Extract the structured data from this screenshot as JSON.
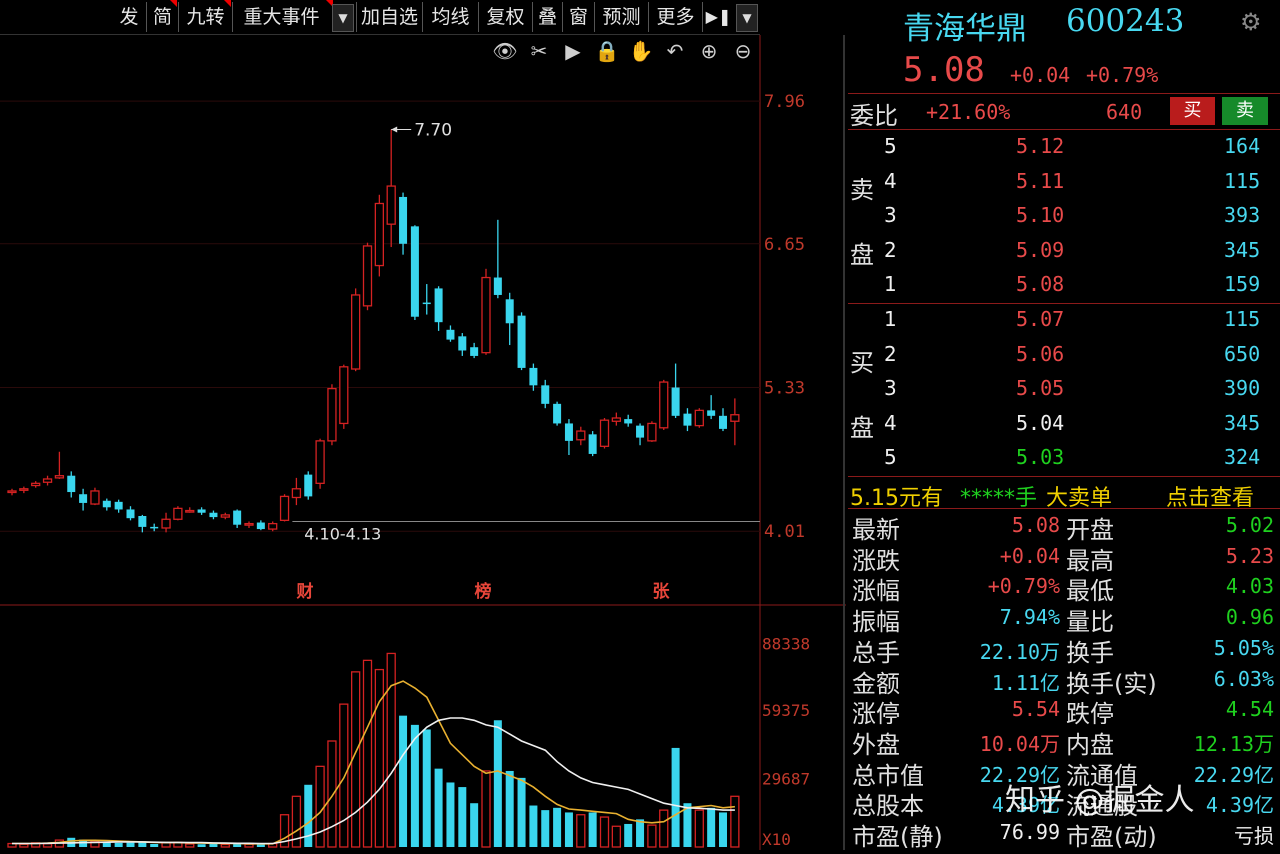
{
  "toolbar": {
    "buttons": [
      "发",
      "简",
      "九转",
      "重大事件",
      "加自选",
      "均线",
      "复权",
      "叠",
      "窗",
      "预测",
      "更多"
    ],
    "chart_tools": [
      "eye-icon",
      "scissors-icon",
      "play-icon",
      "lock-icon",
      "hand-icon",
      "undo-icon",
      "zoom-in-icon",
      "zoom-out-icon"
    ]
  },
  "stock": {
    "name": "青海华鼎",
    "code": "600243",
    "price": "5.08",
    "change": "+0.04",
    "change_pct": "+0.79%"
  },
  "order_ratio": {
    "label": "委比",
    "value": "+21.60%",
    "diff": "640",
    "buy_label": "买",
    "sell_label": "卖"
  },
  "sell_book": {
    "label_chars": [
      "卖",
      "盘"
    ],
    "levels": [
      {
        "level": "5",
        "price": "5.12",
        "vol": "164"
      },
      {
        "level": "4",
        "price": "5.11",
        "vol": "115"
      },
      {
        "level": "3",
        "price": "5.10",
        "vol": "393"
      },
      {
        "level": "2",
        "price": "5.09",
        "vol": "345"
      },
      {
        "level": "1",
        "price": "5.08",
        "vol": "159"
      }
    ]
  },
  "buy_book": {
    "label_chars": [
      "买",
      "盘"
    ],
    "levels": [
      {
        "level": "1",
        "price": "5.07",
        "vol": "115"
      },
      {
        "level": "2",
        "price": "5.06",
        "vol": "650"
      },
      {
        "level": "3",
        "price": "5.05",
        "vol": "390"
      },
      {
        "level": "4",
        "price": "5.04",
        "vol": "345"
      },
      {
        "level": "5",
        "price": "5.03",
        "vol": "324"
      }
    ]
  },
  "big_order": {
    "price_text": "5.15元有",
    "stars": "*****手",
    "label": "大卖单",
    "link": "点击查看"
  },
  "stats": [
    {
      "l1": "最新",
      "v1": "5.08",
      "c1": "red",
      "l2": "开盘",
      "v2": "5.02",
      "c2": "green"
    },
    {
      "l1": "涨跌",
      "v1": "+0.04",
      "c1": "red",
      "l2": "最高",
      "v2": "5.23",
      "c2": "red"
    },
    {
      "l1": "涨幅",
      "v1": "+0.79%",
      "c1": "red",
      "l2": "最低",
      "v2": "4.03",
      "c2": "green"
    },
    {
      "l1": "振幅",
      "v1": "7.94%",
      "c1": "cyan",
      "l2": "量比",
      "v2": "0.96",
      "c2": "green"
    },
    {
      "l1": "总手",
      "v1": "22.10万",
      "c1": "cyan",
      "l2": "换手",
      "v2": "5.05%",
      "c2": "cyan"
    },
    {
      "l1": "金额",
      "v1": "1.11亿",
      "c1": "cyan",
      "l2": "换手(实)",
      "v2": "6.03%",
      "c2": "cyan"
    },
    {
      "l1": "涨停",
      "v1": "5.54",
      "c1": "red",
      "l2": "跌停",
      "v2": "4.54",
      "c2": "green"
    },
    {
      "l1": "外盘",
      "v1": "10.04万",
      "c1": "red",
      "l2": "内盘",
      "v2": "12.13万",
      "c2": "green"
    },
    {
      "l1": "总市值",
      "v1": "22.29亿",
      "c1": "cyan",
      "l2": "流通值",
      "v2": "22.29亿",
      "c2": "cyan"
    },
    {
      "l1": "总股本",
      "v1": "4.39亿",
      "c1": "cyan",
      "l2": "流通股",
      "v2": "4.39亿",
      "c2": "cyan"
    },
    {
      "l1": "市盈(静)",
      "v1": "76.99",
      "c1": "white",
      "l2": "市盈(动)",
      "v2": "亏损",
      "c2": "white"
    }
  ],
  "watermark": "知乎 @掘金人",
  "colors": {
    "up": "#d42222",
    "down": "#3ad6ee",
    "ma_fast": "#e8b030",
    "ma_slow": "#f0f0f0",
    "grid": "#8b1a1a"
  },
  "chart_data": {
    "type": "candlestick",
    "price_axis_ticks": [
      "7.96",
      "6.65",
      "5.33",
      "4.01"
    ],
    "price_ylim": [
      3.7,
      8.2
    ],
    "volume_axis_ticks": [
      "88338",
      "59375",
      "29687",
      "X10"
    ],
    "volume_ylim": [
      0,
      92000
    ],
    "high_marker": "7.70",
    "low_marker": "4.10-4.13",
    "event_markers": [
      "财",
      "榜",
      "张"
    ],
    "candles": [
      {
        "o": 4.37,
        "c": 4.38,
        "h": 4.4,
        "l": 4.34,
        "v": 1500
      },
      {
        "o": 4.39,
        "c": 4.4,
        "h": 4.42,
        "l": 4.36,
        "v": 1200
      },
      {
        "o": 4.43,
        "c": 4.45,
        "h": 4.47,
        "l": 4.41,
        "v": 1800
      },
      {
        "o": 4.46,
        "c": 4.49,
        "h": 4.52,
        "l": 4.43,
        "v": 1400
      },
      {
        "o": 4.5,
        "c": 4.52,
        "h": 4.74,
        "l": 4.49,
        "v": 3000
      },
      {
        "o": 4.52,
        "c": 4.37,
        "h": 4.56,
        "l": 4.32,
        "v": 4000
      },
      {
        "o": 4.35,
        "c": 4.27,
        "h": 4.4,
        "l": 4.2,
        "v": 3200
      },
      {
        "o": 4.26,
        "c": 4.38,
        "h": 4.41,
        "l": 4.25,
        "v": 2600
      },
      {
        "o": 4.29,
        "c": 4.23,
        "h": 4.31,
        "l": 4.2,
        "v": 2200
      },
      {
        "o": 4.28,
        "c": 4.21,
        "h": 4.3,
        "l": 4.18,
        "v": 1800
      },
      {
        "o": 4.21,
        "c": 4.13,
        "h": 4.24,
        "l": 4.11,
        "v": 1900
      },
      {
        "o": 4.15,
        "c": 4.05,
        "h": 4.16,
        "l": 4.0,
        "v": 2500
      },
      {
        "o": 4.05,
        "c": 4.04,
        "h": 4.08,
        "l": 4.01,
        "v": 1300
      },
      {
        "o": 4.04,
        "c": 4.12,
        "h": 4.18,
        "l": 4.0,
        "v": 1800
      },
      {
        "o": 4.12,
        "c": 4.22,
        "h": 4.24,
        "l": 4.11,
        "v": 2000
      },
      {
        "o": 4.19,
        "c": 4.2,
        "h": 4.23,
        "l": 4.18,
        "v": 1300
      },
      {
        "o": 4.21,
        "c": 4.18,
        "h": 4.23,
        "l": 4.16,
        "v": 1200
      },
      {
        "o": 4.18,
        "c": 4.14,
        "h": 4.2,
        "l": 4.12,
        "v": 1400
      },
      {
        "o": 4.14,
        "c": 4.16,
        "h": 4.18,
        "l": 4.12,
        "v": 1100
      },
      {
        "o": 4.2,
        "c": 4.07,
        "h": 4.21,
        "l": 4.04,
        "v": 1700
      },
      {
        "o": 4.07,
        "c": 4.08,
        "h": 4.1,
        "l": 4.04,
        "v": 1200
      },
      {
        "o": 4.09,
        "c": 4.03,
        "h": 4.11,
        "l": 4.02,
        "v": 1300
      },
      {
        "o": 4.03,
        "c": 4.08,
        "h": 4.1,
        "l": 4.01,
        "v": 1500
      },
      {
        "o": 4.11,
        "c": 4.33,
        "h": 4.35,
        "l": 4.1,
        "v": 14000
      },
      {
        "o": 4.32,
        "c": 4.4,
        "h": 4.5,
        "l": 4.25,
        "v": 22000
      },
      {
        "o": 4.53,
        "c": 4.33,
        "h": 4.56,
        "l": 4.3,
        "v": 27000
      },
      {
        "o": 4.45,
        "c": 4.84,
        "h": 4.86,
        "l": 4.4,
        "v": 35000
      },
      {
        "o": 4.84,
        "c": 5.32,
        "h": 5.36,
        "l": 4.8,
        "v": 46000
      },
      {
        "o": 5.0,
        "c": 5.52,
        "h": 5.54,
        "l": 4.95,
        "v": 62000
      },
      {
        "o": 5.5,
        "c": 6.18,
        "h": 6.24,
        "l": 5.48,
        "v": 76000
      },
      {
        "o": 6.08,
        "c": 6.63,
        "h": 6.66,
        "l": 6.04,
        "v": 81000
      },
      {
        "o": 6.45,
        "c": 7.02,
        "h": 7.1,
        "l": 6.35,
        "v": 77000
      },
      {
        "o": 6.83,
        "c": 7.18,
        "h": 7.7,
        "l": 6.62,
        "v": 84000
      },
      {
        "o": 7.08,
        "c": 6.65,
        "h": 7.12,
        "l": 6.55,
        "v": 57000
      },
      {
        "o": 6.81,
        "c": 5.98,
        "h": 6.82,
        "l": 5.95,
        "v": 53000
      },
      {
        "o": 6.11,
        "c": 6.1,
        "h": 6.28,
        "l": 6.0,
        "v": 51000
      },
      {
        "o": 6.24,
        "c": 5.93,
        "h": 6.26,
        "l": 5.85,
        "v": 34000
      },
      {
        "o": 5.86,
        "c": 5.77,
        "h": 5.9,
        "l": 5.75,
        "v": 28000
      },
      {
        "o": 5.8,
        "c": 5.67,
        "h": 5.83,
        "l": 5.62,
        "v": 26000
      },
      {
        "o": 5.7,
        "c": 5.62,
        "h": 5.74,
        "l": 5.6,
        "v": 19000
      },
      {
        "o": 5.65,
        "c": 6.34,
        "h": 6.42,
        "l": 5.63,
        "v": 33000
      },
      {
        "o": 6.34,
        "c": 6.18,
        "h": 6.87,
        "l": 6.15,
        "v": 55000
      },
      {
        "o": 6.14,
        "c": 5.92,
        "h": 6.2,
        "l": 5.72,
        "v": 33000
      },
      {
        "o": 5.99,
        "c": 5.51,
        "h": 6.02,
        "l": 5.49,
        "v": 30000
      },
      {
        "o": 5.51,
        "c": 5.35,
        "h": 5.55,
        "l": 5.3,
        "v": 18000
      },
      {
        "o": 5.35,
        "c": 5.18,
        "h": 5.4,
        "l": 5.14,
        "v": 16000
      },
      {
        "o": 5.18,
        "c": 5.0,
        "h": 5.2,
        "l": 4.98,
        "v": 17000
      },
      {
        "o": 5.0,
        "c": 4.84,
        "h": 5.04,
        "l": 4.71,
        "v": 15000
      },
      {
        "o": 4.85,
        "c": 4.93,
        "h": 4.97,
        "l": 4.8,
        "v": 14000
      },
      {
        "o": 4.9,
        "c": 4.72,
        "h": 4.93,
        "l": 4.7,
        "v": 15000
      },
      {
        "o": 4.79,
        "c": 5.03,
        "h": 5.05,
        "l": 4.77,
        "v": 13000
      },
      {
        "o": 5.02,
        "c": 5.05,
        "h": 5.1,
        "l": 4.98,
        "v": 9000
      },
      {
        "o": 5.04,
        "c": 5.0,
        "h": 5.08,
        "l": 4.97,
        "v": 10000
      },
      {
        "o": 4.98,
        "c": 4.87,
        "h": 5.0,
        "l": 4.8,
        "v": 12000
      },
      {
        "o": 4.84,
        "c": 5.0,
        "h": 5.02,
        "l": 4.83,
        "v": 9500
      },
      {
        "o": 4.96,
        "c": 5.38,
        "h": 5.4,
        "l": 4.94,
        "v": 16000
      },
      {
        "o": 5.33,
        "c": 5.07,
        "h": 5.55,
        "l": 5.05,
        "v": 43000
      },
      {
        "o": 5.09,
        "c": 4.98,
        "h": 5.14,
        "l": 4.93,
        "v": 19000
      },
      {
        "o": 4.98,
        "c": 5.12,
        "h": 5.14,
        "l": 4.96,
        "v": 16000
      },
      {
        "o": 5.12,
        "c": 5.07,
        "h": 5.26,
        "l": 5.04,
        "v": 17000
      },
      {
        "o": 5.07,
        "c": 4.95,
        "h": 5.14,
        "l": 4.93,
        "v": 15000
      },
      {
        "o": 5.02,
        "c": 5.08,
        "h": 5.23,
        "l": 4.8,
        "v": 22000
      }
    ],
    "ma_fast": [
      1500,
      1500,
      1500,
      1700,
      2000,
      2600,
      2900,
      2900,
      2800,
      2600,
      2400,
      2200,
      2000,
      1900,
      1900,
      1800,
      1700,
      1600,
      1500,
      1500,
      1400,
      1400,
      1400,
      3800,
      7000,
      10500,
      15000,
      22000,
      30000,
      41000,
      52000,
      63000,
      70000,
      72000,
      69000,
      65000,
      55000,
      45000,
      40000,
      35000,
      32000,
      33000,
      31000,
      29000,
      26000,
      22000,
      18500,
      16500,
      16000,
      15500,
      15000,
      14500,
      12000,
      11000,
      10500,
      11000,
      14000,
      17000,
      17500,
      18000,
      17000,
      17500
    ],
    "ma_slow": [
      1500,
      1500,
      1500,
      1600,
      1700,
      1800,
      1900,
      2000,
      2100,
      2200,
      2200,
      2200,
      2100,
      2000,
      2000,
      1900,
      1900,
      1800,
      1700,
      1600,
      1600,
      1500,
      1500,
      2400,
      3500,
      4800,
      6500,
      8800,
      11500,
      15000,
      19500,
      25000,
      32000,
      40000,
      47000,
      52000,
      55000,
      56000,
      56000,
      55000,
      53000,
      52000,
      49000,
      46000,
      44000,
      42000,
      37000,
      33000,
      30000,
      28000,
      27000,
      26000,
      25000,
      23000,
      21000,
      19000,
      18000,
      17000,
      16800,
      16500,
      16000,
      16000
    ]
  }
}
